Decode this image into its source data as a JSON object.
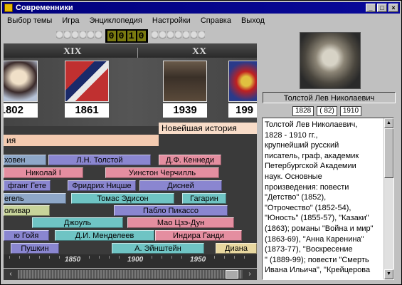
{
  "window": {
    "title": "Современники",
    "btn_min": "_",
    "btn_max": "□",
    "btn_close": "×"
  },
  "menu": [
    "Выбор темы",
    "Игра",
    "Энциклопедия",
    "Настройки",
    "Справка",
    "Выход"
  ],
  "counter": {
    "digits": [
      "0",
      "0",
      "1",
      "0"
    ]
  },
  "centuries": [
    "XIX",
    "XX"
  ],
  "years": [
    "1802",
    "1861",
    "1939",
    "199"
  ],
  "eras": [
    "ия",
    "Новейшая история"
  ],
  "bars": [
    {
      "label": "ховен",
      "color": "#8ea7c8"
    },
    {
      "label": "Л.Н. Толстой",
      "color": "#8a86d0"
    },
    {
      "label": "Д.Ф. Кеннеди",
      "color": "#e48ea0"
    },
    {
      "label": "Николай I",
      "color": "#e48ea0"
    },
    {
      "label": "Уинстон Черчилль",
      "color": "#e48ea0"
    },
    {
      "label": "фганг Гете",
      "color": "#8a86d0"
    },
    {
      "label": "Фридрих Ницше",
      "color": "#8a86d0"
    },
    {
      "label": "Дисней",
      "color": "#8a86d0"
    },
    {
      "label": "егель",
      "color": "#8ea7c8"
    },
    {
      "label": "Томас Эдисон",
      "color": "#6fc4c4"
    },
    {
      "label": "Гагарин",
      "color": "#6fc4c4"
    },
    {
      "label": "оливар",
      "color": "#c8d49a"
    },
    {
      "label": "Пабло Пикассо",
      "color": "#8a86d0"
    },
    {
      "label": "Джоуль",
      "color": "#6fc4c4"
    },
    {
      "label": "Мао Цзэ-Дун",
      "color": "#e48ea0"
    },
    {
      "label": "ю Гойя",
      "color": "#8a86d0"
    },
    {
      "label": "Д.И. Менделеев",
      "color": "#6fc4c4"
    },
    {
      "label": "Индира Ганди",
      "color": "#e48ea0"
    },
    {
      "label": "Пушкин",
      "color": "#8a86d0"
    },
    {
      "label": "А. Эйнштейн",
      "color": "#6fc4c4"
    },
    {
      "label": "Диана",
      "color": "#e8d8a0"
    }
  ],
  "ruler": [
    "1850",
    "1900",
    "1950"
  ],
  "scroll": {
    "left": "‹",
    "right": "›"
  },
  "person": {
    "name": "Толстой Лев Николаевич",
    "birth": "1828",
    "age": "( 82)",
    "death": "1910",
    "text": "Толстой Лев Николаевич,\n1828 - 1910 гг.,\nкрупнейший русский\nписатель, граф, академик\nПетербургской Академии\nнаук. Основные\nпроизведения: повести\n\"Детство\" (1852),\n\"Отрочество\" (1852-54),\n\"Юность\" (1855-57), \"Казаки\"\n(1863); романы \"Война и мир\"\n(1863-69), \"Анна Каренина\"\n(1873-77), \"Воскресение\n\" (1889-99); повести \"Смерть\nИвана Ильича\", \"Крейцерова"
  },
  "vscroll": {
    "up": "▲",
    "down": "▼"
  }
}
